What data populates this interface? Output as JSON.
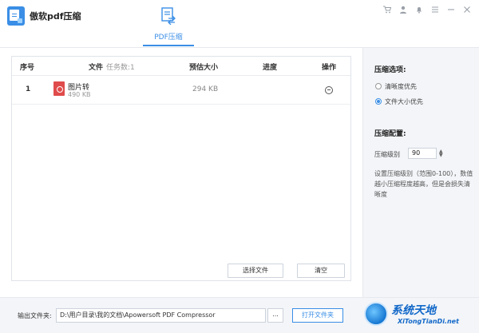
{
  "app": {
    "title": "傲软pdf压缩"
  },
  "tabs": [
    {
      "label": "PDF压缩",
      "active": true
    }
  ],
  "title_icons": [
    "cart-icon",
    "user-icon",
    "bell-icon",
    "menu-icon",
    "minimize-icon",
    "close-icon"
  ],
  "table": {
    "headers": {
      "index": "序号",
      "file": "文件",
      "task_count": "任务数:1",
      "estimated_size": "预估大小",
      "progress": "进度",
      "action": "操作"
    },
    "rows": [
      {
        "index": "1",
        "name": "图片转",
        "size": "490 KB",
        "estimated": "294 KB",
        "progress": ""
      }
    ],
    "buttons": {
      "choose": "选择文件",
      "clear": "清空"
    }
  },
  "options": {
    "heading": "压缩选项:",
    "choices": [
      {
        "label": "清晰度优先",
        "selected": false
      },
      {
        "label": "文件大小优先",
        "selected": true
      }
    ]
  },
  "config": {
    "heading": "压缩配置:",
    "level_label": "压缩级别",
    "level_value": "90",
    "note": "设置压缩级别（范围0-100），数值越小压缩程度越高，但是会损失清晰度"
  },
  "output": {
    "label": "输出文件夹:",
    "path": "D:\\用户目录\\我的文档\\Apowersoft PDF Compressor",
    "browse": "...",
    "open": "打开文件夹"
  },
  "watermark": {
    "title": "系统天地",
    "url": "XiTongTianDi.net"
  },
  "colors": {
    "accent": "#3a8ee6",
    "pdf_red": "#e04b4b"
  }
}
